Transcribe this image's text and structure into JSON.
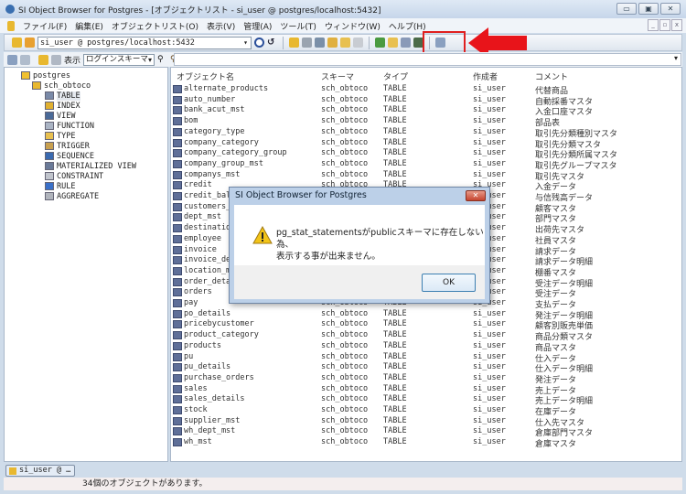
{
  "window": {
    "title": "SI Object Browser for Postgres - [オブジェクトリスト - si_user @ postgres/localhost:5432]",
    "controls": [
      "▭",
      "▣",
      "✕"
    ]
  },
  "menu": {
    "items": [
      "ファイル(F)",
      "編集(E)",
      "オブジェクトリスト(O)",
      "表示(V)",
      "管理(A)",
      "ツール(T)",
      "ウィンドウ(W)",
      "ヘルプ(H)"
    ],
    "mdi_controls": [
      "_",
      "▫",
      "x"
    ]
  },
  "toolbar": {
    "connection": "si_user @ postgres/localhost:5432"
  },
  "filterbar": {
    "display_label": "表示",
    "schema_select": "ログインスキーマ"
  },
  "colors": {
    "highlight": "#e02020",
    "arrow": "#e8141a"
  },
  "tree": {
    "root": "postgres",
    "schema": "sch_obtoco",
    "items": [
      "TABLE",
      "INDEX",
      "VIEW",
      "FUNCTION",
      "TYPE",
      "TRIGGER",
      "SEQUENCE",
      "MATERIALIZED VIEW",
      "CONSTRAINT",
      "RULE",
      "AGGREGATE"
    ],
    "selected": "TABLE"
  },
  "list": {
    "headers": [
      "オブジェクト名",
      "スキーマ",
      "タイプ",
      "作成者",
      "コメント"
    ],
    "rows": [
      [
        "alternate_products",
        "sch_obtoco",
        "TABLE",
        "si_user",
        "代替商品"
      ],
      [
        "auto_number",
        "sch_obtoco",
        "TABLE",
        "si_user",
        "自動採番マスタ"
      ],
      [
        "bank_acut_mst",
        "sch_obtoco",
        "TABLE",
        "si_user",
        "入金口座マスタ"
      ],
      [
        "bom",
        "sch_obtoco",
        "TABLE",
        "si_user",
        "部品表"
      ],
      [
        "category_type",
        "sch_obtoco",
        "TABLE",
        "si_user",
        "取引先分類種別マスタ"
      ],
      [
        "company_category",
        "sch_obtoco",
        "TABLE",
        "si_user",
        "取引先分類マスタ"
      ],
      [
        "company_category_group",
        "sch_obtoco",
        "TABLE",
        "si_user",
        "取引先分類所属マスタ"
      ],
      [
        "company_group_mst",
        "sch_obtoco",
        "TABLE",
        "si_user",
        "取引先グループマスタ"
      ],
      [
        "companys_mst",
        "sch_obtoco",
        "TABLE",
        "si_user",
        "取引先マスタ"
      ],
      [
        "credit",
        "sch_obtoco",
        "TABLE",
        "si_user",
        "入金データ"
      ],
      [
        "credit_bal",
        "sch_obtoco",
        "TABLE",
        "si_user",
        "与信残高データ"
      ],
      [
        "customers_",
        "sch_obtoco",
        "TABLE",
        "si_user",
        "顧客マスタ"
      ],
      [
        "dept_mst",
        "sch_obtoco",
        "TABLE",
        "si_user",
        "部門マスタ"
      ],
      [
        "destinatio",
        "sch_obtoco",
        "TABLE",
        "si_user",
        "出荷先マスタ"
      ],
      [
        "employee",
        "sch_obtoco",
        "TABLE",
        "si_user",
        "社員マスタ"
      ],
      [
        "invoice",
        "sch_obtoco",
        "TABLE",
        "si_user",
        "請求データ"
      ],
      [
        "invoice_de",
        "sch_obtoco",
        "TABLE",
        "si_user",
        "請求データ明細"
      ],
      [
        "location_m",
        "sch_obtoco",
        "TABLE",
        "si_user",
        "棚番マスタ"
      ],
      [
        "order_deta",
        "sch_obtoco",
        "TABLE",
        "si_user",
        "受注データ明細"
      ],
      [
        "orders",
        "sch_obtoco",
        "TABLE",
        "si_user",
        "受注データ"
      ],
      [
        "pay",
        "sch_obtoco",
        "TABLE",
        "si_user",
        "支払データ"
      ],
      [
        "po_details",
        "sch_obtoco",
        "TABLE",
        "si_user",
        "発注データ明細"
      ],
      [
        "pricebycustomer",
        "sch_obtoco",
        "TABLE",
        "si_user",
        "顧客別販売単価"
      ],
      [
        "product_category",
        "sch_obtoco",
        "TABLE",
        "si_user",
        "商品分類マスタ"
      ],
      [
        "products",
        "sch_obtoco",
        "TABLE",
        "si_user",
        "商品マスタ"
      ],
      [
        "pu",
        "sch_obtoco",
        "TABLE",
        "si_user",
        "仕入データ"
      ],
      [
        "pu_details",
        "sch_obtoco",
        "TABLE",
        "si_user",
        "仕入データ明細"
      ],
      [
        "purchase_orders",
        "sch_obtoco",
        "TABLE",
        "si_user",
        "発注データ"
      ],
      [
        "sales",
        "sch_obtoco",
        "TABLE",
        "si_user",
        "売上データ"
      ],
      [
        "sales_details",
        "sch_obtoco",
        "TABLE",
        "si_user",
        "売上データ明細"
      ],
      [
        "stock",
        "sch_obtoco",
        "TABLE",
        "si_user",
        "在庫データ"
      ],
      [
        "supplier_mst",
        "sch_obtoco",
        "TABLE",
        "si_user",
        "仕入先マスタ"
      ],
      [
        "wh_dept_mst",
        "sch_obtoco",
        "TABLE",
        "si_user",
        "倉庫部門マスタ"
      ],
      [
        "wh_mst",
        "sch_obtoco",
        "TABLE",
        "si_user",
        "倉庫マスタ"
      ]
    ]
  },
  "window_tab": {
    "label": "si_user @ …"
  },
  "status": {
    "text": "34個のオブジェクトがあります。"
  },
  "dialog": {
    "title": "SI Object Browser for Postgres",
    "close": "✕",
    "message_line1": "pg_stat_statementsがpublicスキーマに存在しない為、",
    "message_line2": "表示する事が出来ません。",
    "ok_label": "OK",
    "icon": "warning-icon"
  }
}
